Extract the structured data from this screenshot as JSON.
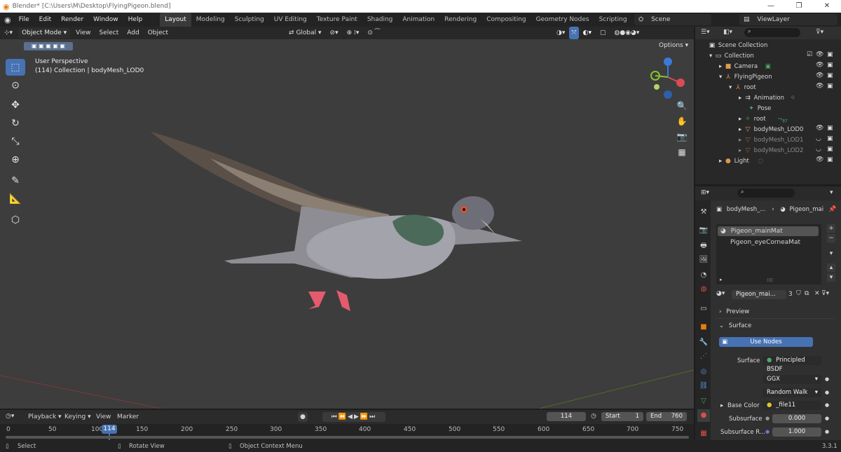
{
  "window": {
    "title": "Blender* [C:\\Users\\M\\Desktop\\FlyingPigeon.blend]"
  },
  "menu": [
    "File",
    "Edit",
    "Render",
    "Window",
    "Help"
  ],
  "workspaces": [
    "Layout",
    "Modeling",
    "Sculpting",
    "UV Editing",
    "Texture Paint",
    "Shading",
    "Animation",
    "Rendering",
    "Compositing",
    "Geometry Nodes",
    "Scripting"
  ],
  "scene": "Scene",
  "view_layer": "ViewLayer",
  "viewport": {
    "mode": "Object Mode",
    "menus": [
      "View",
      "Select",
      "Add",
      "Object"
    ],
    "orientation": "Global",
    "options_label": "Options",
    "view_name": "User Perspective",
    "collection_info": "(114) Collection | bodyMesh_LOD0"
  },
  "outliner": {
    "title": "Scene Collection",
    "rows": [
      {
        "label": "Collection",
        "icon": "collection-icon"
      },
      {
        "label": "Camera",
        "icon": "camera-icon"
      },
      {
        "label": "FlyingPigeon",
        "icon": "armature-icon"
      },
      {
        "label": "root",
        "icon": "armature-icon"
      },
      {
        "label": "Animation",
        "icon": "action-icon"
      },
      {
        "label": "Pose",
        "icon": "pose-icon"
      },
      {
        "label": "root",
        "icon": "bone-icon"
      },
      {
        "label": "bodyMesh_LOD0",
        "icon": "mesh-icon"
      },
      {
        "label": "bodyMesh_LOD1",
        "icon": "mesh-icon"
      },
      {
        "label": "bodyMesh_LOD2",
        "icon": "mesh-icon"
      },
      {
        "label": "Light",
        "icon": "light-icon"
      }
    ],
    "bone_count": "87"
  },
  "properties": {
    "breadcrumb_object": "bodyMesh_...",
    "breadcrumb_material": "Pigeon_mai",
    "materials": [
      "Pigeon_mainMat",
      "Pigeon_eyeCorneaMat"
    ],
    "material_name": "Pigeon_mai...",
    "user_count": "3",
    "preview_label": "Preview",
    "surface_label": "Surface",
    "use_nodes": "Use Nodes",
    "surface_field_label": "Surface",
    "surface_value": "Principled BSDF",
    "distribution": "GGX",
    "subsurface_method": "Random Walk",
    "base_color_label": "Base Color",
    "base_color_value": "_file11",
    "subsurface_label": "Subsurface",
    "subsurface_value": "0.000",
    "subsurface_r_label": "Subsurface R...",
    "subsurface_r_value": "1.000"
  },
  "timeline": {
    "menus": [
      "Playback",
      "Keying",
      "View",
      "Marker"
    ],
    "current_frame": "114",
    "start_label": "Start",
    "start": "1",
    "end_label": "End",
    "end": "760",
    "ticks": [
      "0",
      "50",
      "100",
      "150",
      "200",
      "250",
      "300",
      "350",
      "400",
      "450",
      "500",
      "550",
      "600",
      "650",
      "700",
      "750"
    ]
  },
  "status": {
    "select": "Select",
    "rotate": "Rotate View",
    "context": "Object Context Menu",
    "version": "3.3.1"
  },
  "colors": {
    "accent": "#4772b3",
    "background": "#3d3d3d",
    "panel": "#303030"
  }
}
